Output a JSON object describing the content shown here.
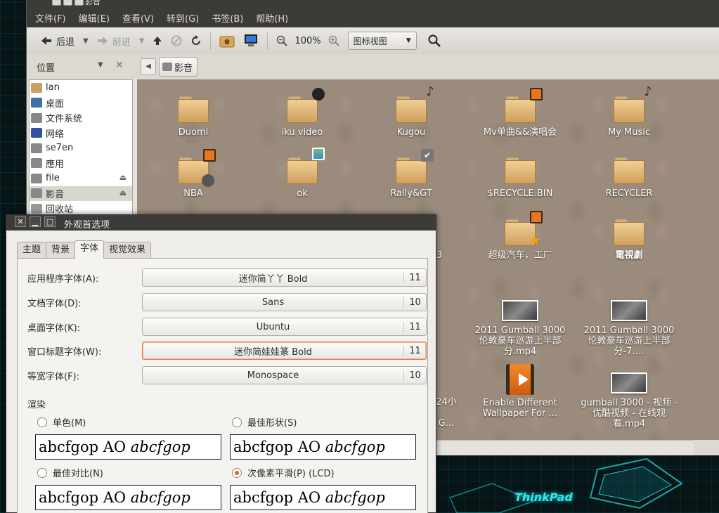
{
  "window": {
    "title": "影音"
  },
  "menu": [
    "文件(F)",
    "编辑(E)",
    "查看(V)",
    "转到(G)",
    "书签(B)",
    "帮助(H)"
  ],
  "toolbar": {
    "back": "后退",
    "forward": "前进",
    "zoom": "100%",
    "view_mode": "图标视图"
  },
  "location": {
    "places_label": "位置",
    "crumb": "影音"
  },
  "sidebar": [
    {
      "label": "lan",
      "icon": "home-folder-icon",
      "color": "#c8a060"
    },
    {
      "label": "桌面",
      "icon": "desktop-icon",
      "color": "#3d6fa8"
    },
    {
      "label": "文件系统",
      "icon": "drive-icon",
      "color": "#888888"
    },
    {
      "label": "网络",
      "icon": "network-icon",
      "color": "#3050a0"
    },
    {
      "label": "se7en",
      "icon": "drive-icon",
      "color": "#888888"
    },
    {
      "label": "應用",
      "icon": "drive-icon",
      "color": "#888888"
    },
    {
      "label": "file",
      "icon": "drive-icon",
      "color": "#888888",
      "eject": true
    },
    {
      "label": "影音",
      "icon": "drive-icon",
      "color": "#888888",
      "eject": true,
      "selected": true
    },
    {
      "label": "回收站",
      "icon": "trash-icon",
      "color": "#999999"
    }
  ],
  "files": {
    "duomi": "Duomi",
    "iku": "iku video",
    "kugou": "Kugou",
    "mv": "Mv单曲&&演唱会",
    "mymusic": "My Music",
    "nba": "NBA",
    "ok": "ok",
    "rally": "Rally&GT",
    "recyclebin": "$RECYCLE.BIN",
    "recycler": "RECYCLER",
    "supercar": "超级汽车，工厂",
    "tvshow": "電視劇",
    "gumball1": "2011 Gumball 3000 伦敦豪车巡游上半部分.mp4",
    "gumball2": "2011 Gumball 3000 伦敦豪车巡游上半部分-7.…",
    "enable": "Enable Different Wallpaper For …",
    "gumball3": "gumball 3000 - 视频 - 优酷视频 - 在线观看.mp4",
    "partial1": "3",
    "partial2": "24小",
    "partial3": "G…"
  },
  "dialog": {
    "title": "外观首选项",
    "tabs": [
      "主题",
      "背景",
      "字体",
      "视觉效果"
    ],
    "fonts": [
      {
        "label": "应用程序字体(A):",
        "name": "迷你简丫丫 Bold",
        "size": "11"
      },
      {
        "label": "文档字体(D):",
        "name": "Sans",
        "size": "10"
      },
      {
        "label": "桌面字体(K):",
        "name": "Ubuntu",
        "size": "11"
      },
      {
        "label": "窗口标题字体(W):",
        "name": "迷你简娃娃篆 Bold",
        "size": "11"
      },
      {
        "label": "等宽字体(F):",
        "name": "Monospace",
        "size": "10"
      }
    ],
    "rendering_label": "渲染",
    "options": [
      {
        "label": "单色(M)",
        "checked": false
      },
      {
        "label": "最佳形状(S)",
        "checked": false
      },
      {
        "label": "最佳对比(N)",
        "checked": false
      },
      {
        "label": "次像素平滑(P) (LCD)",
        "checked": true
      }
    ],
    "sample_plain": "abcfgop AO ",
    "sample_italic": "abcfgop"
  },
  "desktop": {
    "brand": "ThinkPad"
  }
}
